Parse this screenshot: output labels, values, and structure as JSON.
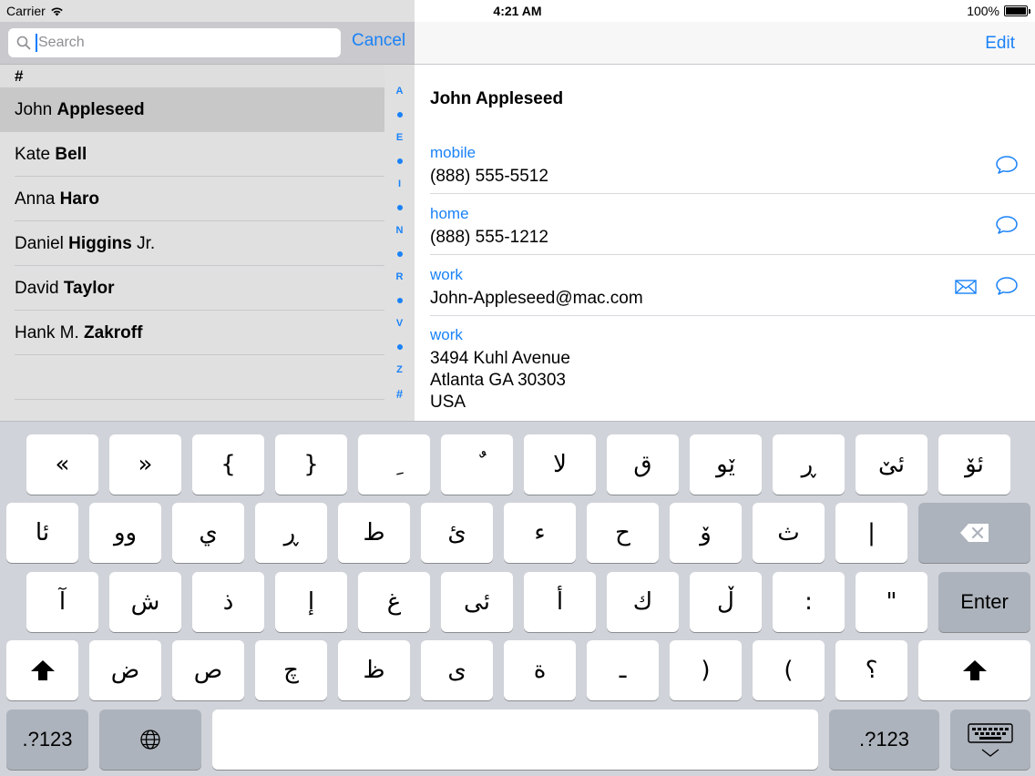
{
  "status": {
    "carrier": "Carrier",
    "time": "4:21 AM",
    "battery": "100%"
  },
  "search": {
    "placeholder": "Search",
    "value": "",
    "cancel": "Cancel"
  },
  "list": {
    "section": "#",
    "contacts": [
      {
        "first": "John ",
        "last": "Appleseed",
        "suffix": "",
        "selected": true
      },
      {
        "first": "Kate ",
        "last": "Bell",
        "suffix": "",
        "selected": false
      },
      {
        "first": "Anna ",
        "last": "Haro",
        "suffix": "",
        "selected": false
      },
      {
        "first": "Daniel ",
        "last": "Higgins",
        "suffix": " Jr.",
        "selected": false
      },
      {
        "first": "David ",
        "last": "Taylor",
        "suffix": "",
        "selected": false
      },
      {
        "first": "Hank M. ",
        "last": "Zakroff",
        "suffix": "",
        "selected": false
      }
    ],
    "index": [
      "A",
      "•",
      "E",
      "•",
      "I",
      "•",
      "N",
      "•",
      "R",
      "•",
      "V",
      "•",
      "Z",
      "#"
    ]
  },
  "detail": {
    "edit": "Edit",
    "name": "John Appleseed",
    "fields": [
      {
        "label": "mobile",
        "value": "(888) 555-5512"
      },
      {
        "label": "home",
        "value": "(888) 555-1212"
      },
      {
        "label": "work",
        "value": "John-Appleseed@mac.com"
      },
      {
        "label": "work",
        "value": "3494 Kuhl Avenue\nAtlanta GA 30303\nUSA"
      }
    ]
  },
  "keyboard": {
    "row1": [
      "«",
      "»",
      "{",
      "}",
      "ِ",
      "ٌ",
      "لا",
      "ق",
      "ێو",
      "ڕ",
      "ئێ",
      "ئۆ"
    ],
    "row2": [
      "ئا",
      "وو",
      "ي",
      "ڕ",
      "ط",
      "ئ",
      "ء",
      "ح",
      "ۆ",
      "ث",
      "|"
    ],
    "row3": [
      "آ",
      "ش",
      "ذ",
      "إ",
      "غ",
      "ئى",
      "أ",
      "ك",
      "ڵ",
      ":",
      "\""
    ],
    "row4": [
      "ض",
      "ص",
      "چ",
      "ظ",
      "ى",
      "ة",
      "ـ",
      ")",
      "(",
      "؟"
    ],
    "enter": "Enter",
    "numbers": ".?123",
    "colors": {
      "accent": "#1a82f7",
      "key": "#ffffff",
      "function_key": "#adb3bc"
    }
  }
}
